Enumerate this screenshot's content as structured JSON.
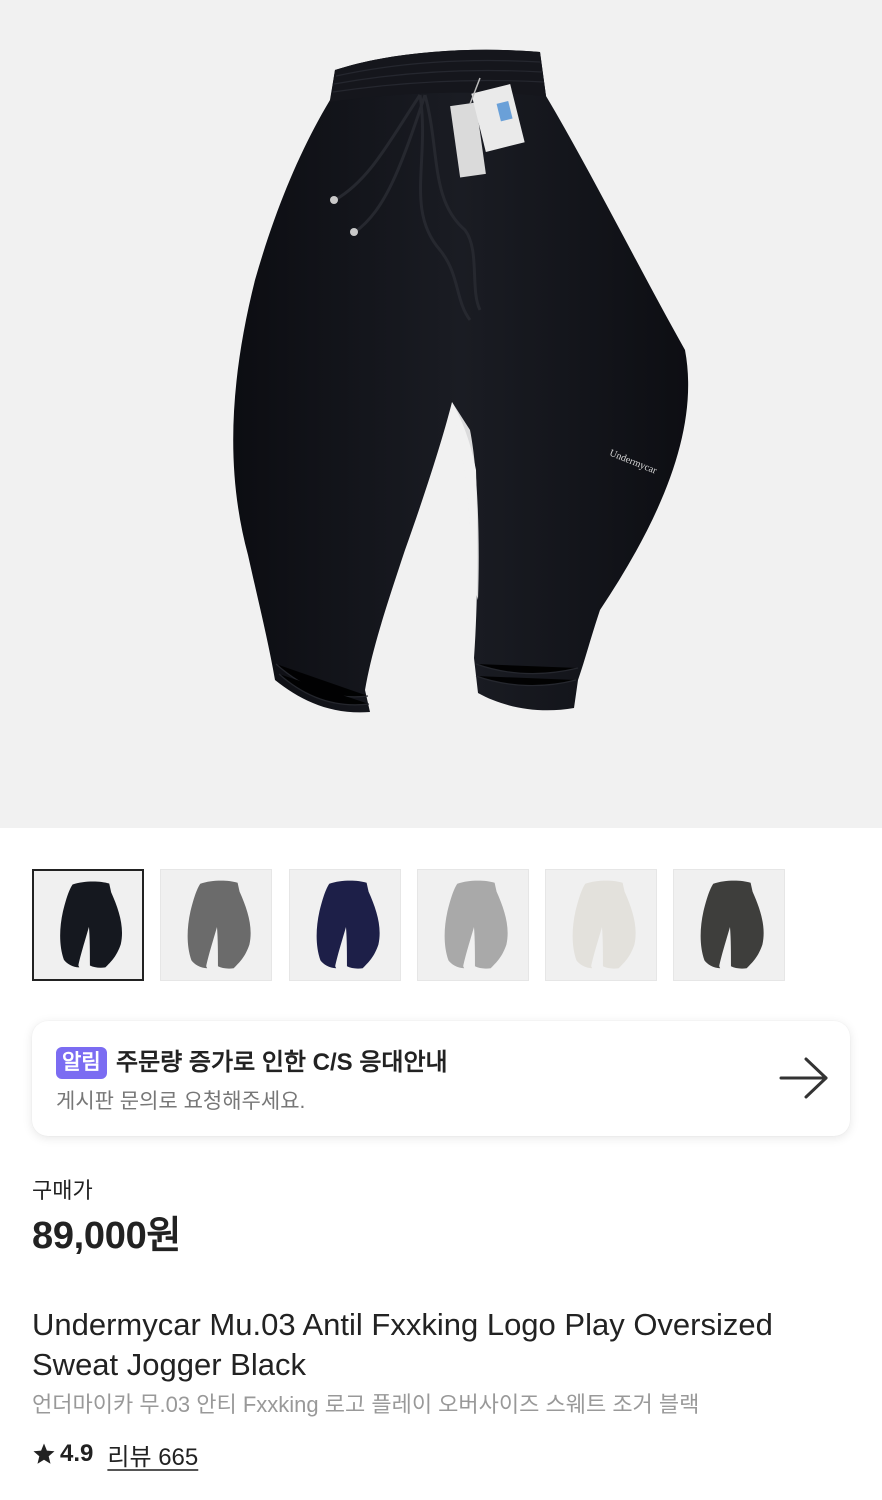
{
  "product_image": {
    "icon": "black-jogger-pants-image",
    "brand_print": "Undermycar"
  },
  "thumbnails": [
    {
      "name": "black",
      "color": "#15181f",
      "selected": true
    },
    {
      "name": "charcoal-gray",
      "color": "#6b6b6b",
      "selected": false
    },
    {
      "name": "navy",
      "color": "#1d1f48",
      "selected": false
    },
    {
      "name": "light-gray",
      "color": "#a9a9a9",
      "selected": false
    },
    {
      "name": "ivory",
      "color": "#e3e1dc",
      "selected": false
    },
    {
      "name": "dark-gray",
      "color": "#3e3e3c",
      "selected": false
    }
  ],
  "notice": {
    "badge": "알림",
    "title": "주문량 증가로 인한 C/S 응대안내",
    "subtitle": "게시판 문의로 요청해주세요.",
    "icon": "arrow-right-icon",
    "badge_color": "#7b6cf2"
  },
  "price": {
    "label": "구매가",
    "value": "89,000원"
  },
  "product": {
    "name_en": "Undermycar Mu.03 Antil Fxxking Logo Play Oversized Sweat Jogger Black",
    "name_ko": "언더마이카 무.03 안티 Fxxking 로고 플레이 오버사이즈 스웨트 조거 블랙"
  },
  "rating": {
    "icon": "star-icon",
    "value": "4.9",
    "review_text": "리뷰 665"
  }
}
